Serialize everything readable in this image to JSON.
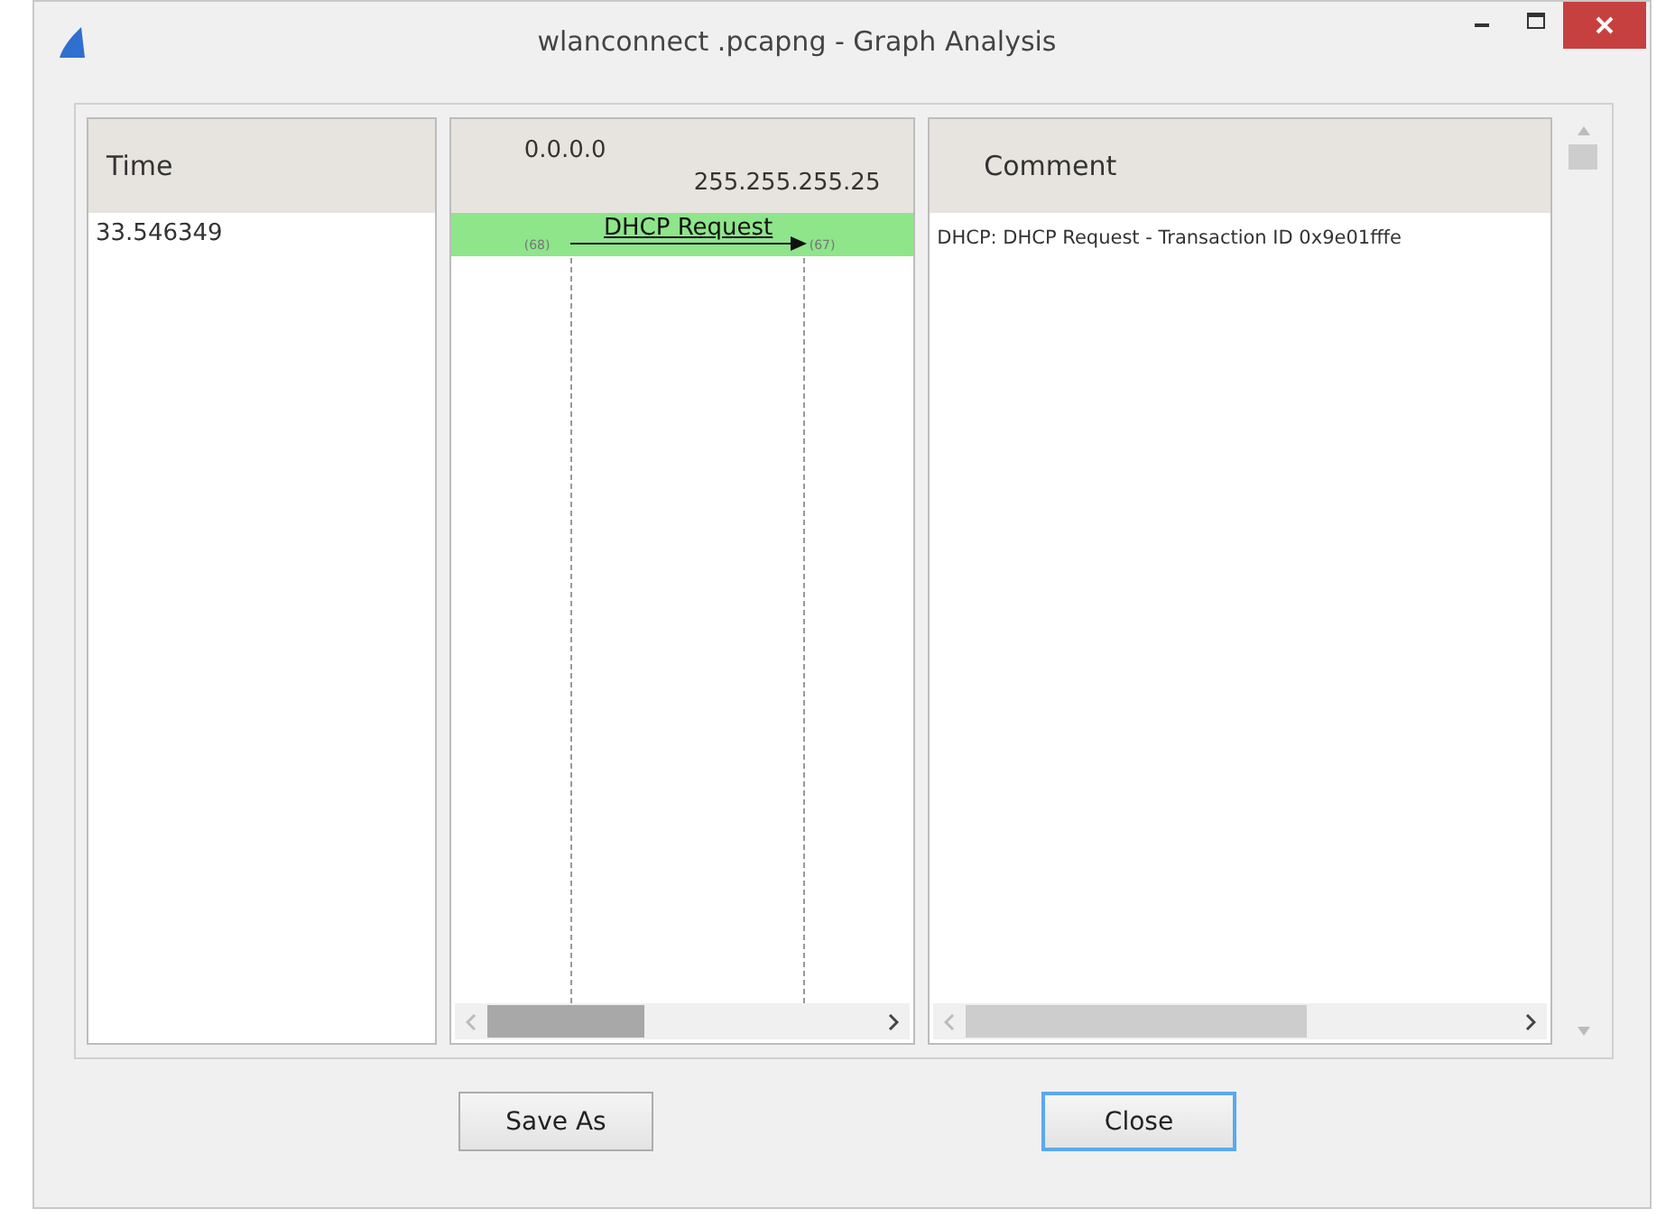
{
  "window": {
    "title": "wlanconnect .pcapng - Graph Analysis"
  },
  "time_column": {
    "heading": "Time",
    "rows": [
      "33.546349"
    ]
  },
  "graph": {
    "nodes": [
      "0.0.0.0",
      "255.255.255.25"
    ],
    "flows": [
      {
        "label": "DHCP Request",
        "src_port": "(68)",
        "dst_port": "(67)",
        "selected": true
      }
    ]
  },
  "comment_column": {
    "heading": "Comment",
    "rows": [
      "DHCP: DHCP Request  - Transaction ID 0x9e01fffe"
    ]
  },
  "buttons": [
    {
      "label": "Save As",
      "focused": false
    },
    {
      "label": "Close",
      "focused": true
    }
  ]
}
